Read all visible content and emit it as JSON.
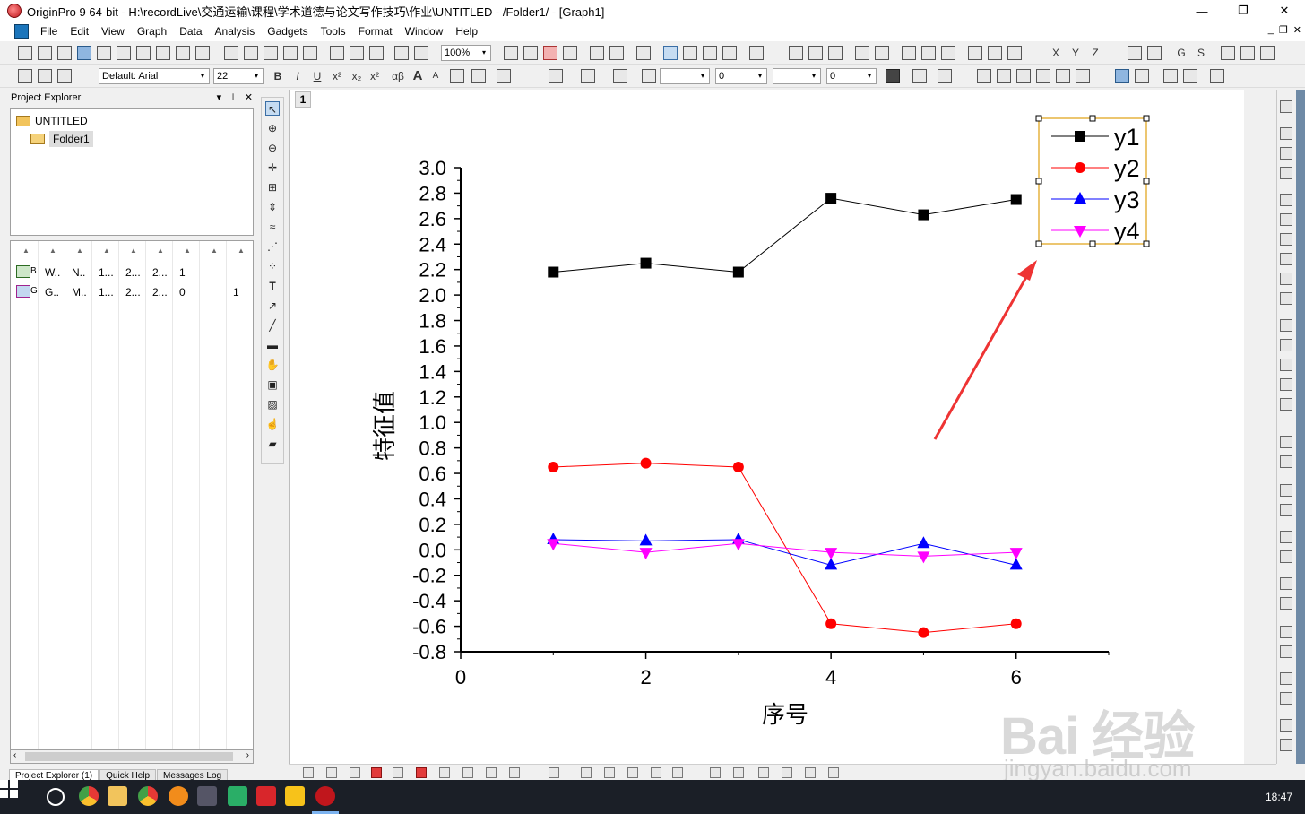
{
  "window": {
    "title": "OriginPro 9 64-bit - H:\\recordLive\\交通运输\\课程\\学术道德与论文写作技巧\\作业\\UNTITLED - /Folder1/ - [Graph1]",
    "minimize_glyph": "—",
    "restore_glyph": "❐",
    "close_glyph": "✕"
  },
  "menu": {
    "items": [
      "File",
      "Edit",
      "View",
      "Graph",
      "Data",
      "Analysis",
      "Gadgets",
      "Tools",
      "Format",
      "Window",
      "Help"
    ],
    "mdi_min": "_",
    "mdi_restore": "❐",
    "mdi_close": "✕"
  },
  "toolbar": {
    "zoom": "100%",
    "font": "Default: Arial",
    "font_size": "22",
    "line_width_value": "0",
    "pattern_value": "0",
    "bold": "B",
    "italic": "I",
    "underline": "U",
    "superscript": "x²",
    "subscript": "x₂",
    "greek": "αβ",
    "font_up": "A",
    "font_down": "A",
    "dropdown_arrow": "▾",
    "xyz": [
      "X",
      "Y",
      "Z"
    ],
    "gs": [
      "G",
      "S"
    ]
  },
  "project_explorer": {
    "title": "Project Explorer",
    "header_btns": [
      "▾",
      "⊥",
      "✕"
    ],
    "root": "UNTITLED",
    "folder": "Folder1",
    "rows": [
      {
        "c1": "B",
        "c2": "W..",
        "c3": "N..",
        "c4": "1...",
        "c5": "2...",
        "c6": "2...",
        "c7": "1",
        "c8": ""
      },
      {
        "c1": "G",
        "c2": "G..",
        "c3": "M..",
        "c4": "1...",
        "c5": "2...",
        "c6": "2...",
        "c7": "0",
        "c8": "1"
      }
    ],
    "tabs": [
      "Project Explorer (1)",
      "Quick Help",
      "Messages Log"
    ]
  },
  "graph": {
    "layer_label": "1"
  },
  "chart_data": {
    "type": "line",
    "xlabel": "序号",
    "ylabel": "特征值",
    "xlim": [
      0,
      7
    ],
    "ylim": [
      -0.8,
      3.0
    ],
    "x_ticks": [
      0,
      2,
      4,
      6
    ],
    "x_tick_labels": [
      "0",
      "2",
      "4",
      "6"
    ],
    "y_ticks": [
      3.0,
      2.8,
      2.6,
      2.4,
      2.2,
      2.0,
      1.8,
      1.6,
      1.4,
      1.2,
      1.0,
      0.8,
      0.6,
      0.4,
      0.2,
      0.0,
      -0.2,
      -0.4,
      -0.6,
      -0.8
    ],
    "y_tick_labels": [
      "3.0",
      "2.8",
      "2.6",
      "2.4",
      "2.2",
      "2.0",
      "1.8",
      "1.6",
      "1.4",
      "1.2",
      "1.0",
      "0.8",
      "0.6",
      "0.4",
      "0.2",
      "0.0",
      "-0.2",
      "-0.4",
      "-0.6",
      "-0.8"
    ],
    "x": [
      1,
      2,
      3,
      4,
      5,
      6
    ],
    "series": [
      {
        "name": "y1",
        "color": "#000000",
        "marker": "square",
        "values": [
          2.18,
          2.25,
          2.18,
          2.76,
          2.63,
          2.75
        ]
      },
      {
        "name": "y2",
        "color": "#ff0000",
        "marker": "circle",
        "values": [
          0.65,
          0.68,
          0.65,
          -0.58,
          -0.65,
          -0.58
        ]
      },
      {
        "name": "y3",
        "color": "#0000ff",
        "marker": "triangle-up",
        "values": [
          0.08,
          0.07,
          0.08,
          -0.12,
          0.05,
          -0.12
        ]
      },
      {
        "name": "y4",
        "color": "#ff00ff",
        "marker": "triangle-down",
        "values": [
          0.05,
          -0.02,
          0.05,
          -0.02,
          -0.05,
          -0.02
        ]
      }
    ],
    "legend": "top-right",
    "grid": false,
    "annotation": {
      "type": "arrow",
      "color": "#ee3333",
      "points_to": "legend"
    }
  },
  "watermark": {
    "main": "Bai 经验",
    "sub": "jingyan.baidu.com"
  },
  "taskbar": {
    "clock": "18:47"
  }
}
